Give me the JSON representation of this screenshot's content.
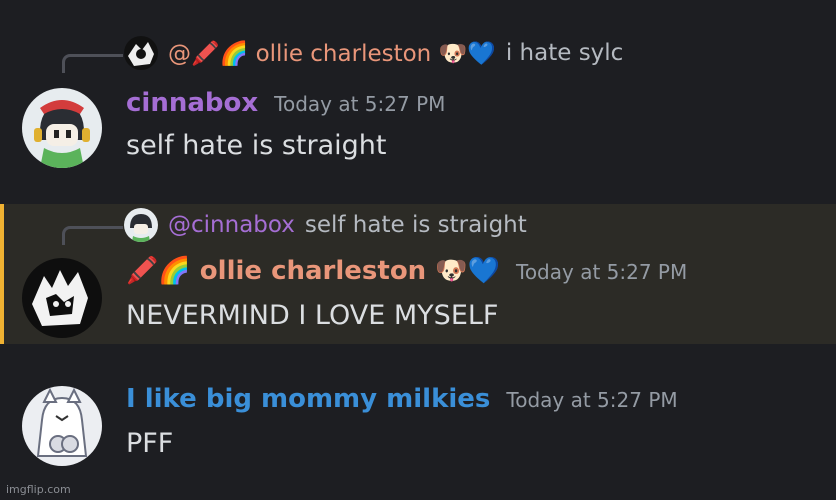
{
  "messages": [
    {
      "reply": {
        "name": "@🖍️🌈 ollie charleston 🐶💙",
        "text": "i hate sylc"
      },
      "author": "cinnabox",
      "author_color": "#a56ed4",
      "timestamp": "Today at 5:27 PM",
      "content": "self hate is straight"
    },
    {
      "reply": {
        "name": "@cinnabox",
        "text": "self hate is straight"
      },
      "author": "🖍️🌈 ollie charleston 🐶💙",
      "author_color": "#e9967a",
      "timestamp": "Today at 5:27 PM",
      "content": "NEVERMIND I LOVE MYSELF",
      "highlighted": true
    },
    {
      "author": "I like big mommy milkies",
      "author_color": "#3a8fd8",
      "timestamp": "Today at 5:27 PM",
      "content": "PFF"
    }
  ],
  "watermark": "imgflip.com",
  "colors": {
    "background": "#1d1e22",
    "mention_highlight": "#2c2b26",
    "mention_bar": "#f0b232"
  }
}
